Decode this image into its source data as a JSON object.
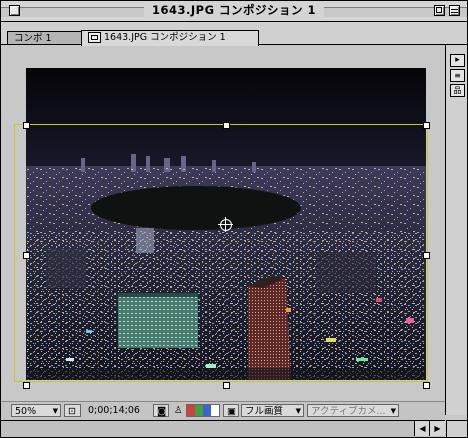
{
  "window": {
    "title": "1643.JPG コンポジション 1"
  },
  "tabs": [
    {
      "label": "コンポ 1"
    },
    {
      "label": "1643.JPG コンポジション 1"
    }
  ],
  "controls": {
    "zoom": "50%",
    "timecode": "0;00;14;06",
    "resolution": "フル画質",
    "camera": "アクティブカメ..."
  },
  "colors": {
    "bbox": "#c8c820",
    "channel_red": "#d04040",
    "channel_green": "#40a040",
    "channel_blue": "#4060d0"
  },
  "icons": [
    "close-icon",
    "zoom-icon",
    "collapse-icon",
    "composition-icon",
    "region-icon",
    "camera-icon",
    "person-icon",
    "channels-icon",
    "proxy-icon",
    "scroll-left-icon",
    "scroll-right-icon",
    "grow-icon"
  ]
}
